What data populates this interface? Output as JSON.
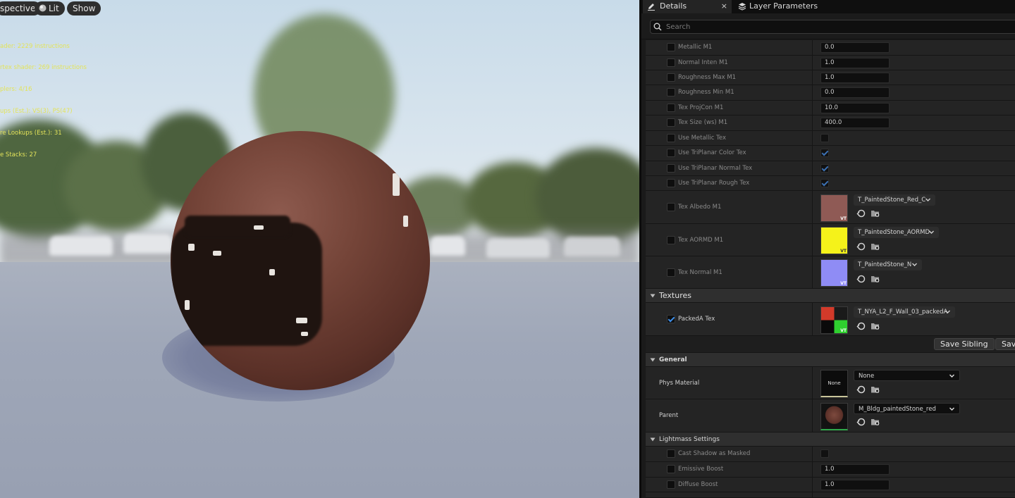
{
  "viewport": {
    "buttons": {
      "perspective": "spective",
      "lit": "Lit",
      "show": "Show"
    },
    "stats": [
      "ader: 2229 instructions",
      "rtex shader: 269 instructions",
      "plers: 4/16",
      "ups (Est.): VS(3), PS(47)",
      "re Lookups (Est.): 31",
      "e Stacks: 27"
    ]
  },
  "tabs": {
    "details": "Details",
    "details_close": "×",
    "layer_parameters": "Layer Parameters"
  },
  "search": {
    "placeholder": "Search"
  },
  "params": [
    {
      "label": "Metallic M1",
      "value": "0.0"
    },
    {
      "label": "Normal Inten M1",
      "value": "1.0"
    },
    {
      "label": "Roughness Max M1",
      "value": "1.0"
    },
    {
      "label": "Roughness Min M1",
      "value": "0.0"
    },
    {
      "label": "Tex ProjCon M1",
      "value": "10.0"
    },
    {
      "label": "Tex Size (ws) M1",
      "value": "400.0"
    },
    {
      "label": "Use Metallic Tex",
      "checked": false
    },
    {
      "label": "Use TriPlanar Color Tex",
      "checked": true
    },
    {
      "label": "Use TriPlanar Normal Tex",
      "checked": true
    },
    {
      "label": "Use TriPlanar Rough Tex",
      "checked": true
    }
  ],
  "textures_m1": [
    {
      "label": "Tex Albedo M1",
      "asset": "T_PaintedStone_Red_C",
      "thumb_color": "#8f5a55",
      "vt": "VT"
    },
    {
      "label": "Tex AORMD M1",
      "asset": "T_PaintedStone_AORMD",
      "thumb_color": "#f5f21a",
      "vt": "VT"
    },
    {
      "label": "Tex Normal M1",
      "asset": "T_PaintedStone_N",
      "thumb_color": "#8f8cf5",
      "vt": "VT"
    }
  ],
  "textures_section": {
    "title": "Textures",
    "packed": {
      "label": "PackedA Tex",
      "asset": "T_NYA_L2_F_Wall_03_packedA",
      "checked": true,
      "vt": "VT"
    }
  },
  "save_buttons": {
    "save_sibling": "Save Sibling",
    "save_child": "Sav"
  },
  "general": {
    "title": "General",
    "phys_material": {
      "label": "Phys Material",
      "thumb_text": "None",
      "value": "None"
    },
    "parent": {
      "label": "Parent",
      "value": "M_Bldg_paintedStone_red"
    }
  },
  "lightmass": {
    "title": "Lightmass Settings",
    "rows": [
      {
        "label": "Cast Shadow as Masked",
        "checked": false
      },
      {
        "label": "Emissive Boost",
        "value": "1.0"
      },
      {
        "label": "Diffuse Boost",
        "value": "1.0"
      }
    ]
  },
  "colors": {
    "accent_blue": "#3d8ee8",
    "panel_bg": "#1a1a1a",
    "row_bg": "#242424",
    "stats_yellow": "#e3e35a"
  }
}
